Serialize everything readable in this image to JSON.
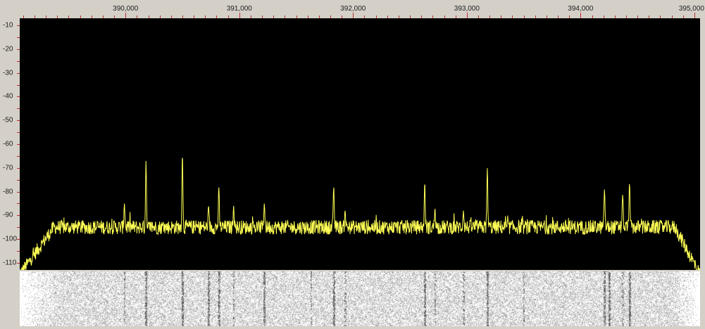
{
  "frequency_axis": {
    "labels": [
      "390,000",
      "391,000",
      "392,000",
      "393,000",
      "394,000",
      "395,000"
    ],
    "values": [
      390,
      391,
      392,
      393,
      394,
      395
    ],
    "range": [
      389.07,
      395.05
    ]
  },
  "level_axis": {
    "labels": [
      "-10",
      "-20",
      "-30",
      "-40",
      "-50",
      "-60",
      "-70",
      "-80",
      "-90",
      "-100",
      "-110"
    ],
    "values": [
      -10,
      -20,
      -30,
      -40,
      -50,
      -60,
      -70,
      -80,
      -90,
      -100,
      -110
    ],
    "range": [
      -7,
      -113
    ]
  },
  "spectrum": {
    "trace_color": "#ffff55",
    "background_color": "#000000",
    "noise_floor_db": -95,
    "band_edges": [
      389.07,
      395.05
    ],
    "peaks": [
      {
        "freq": 389.99,
        "level": -85
      },
      {
        "freq": 390.18,
        "level": -67
      },
      {
        "freq": 390.5,
        "level": -64
      },
      {
        "freq": 390.73,
        "level": -86
      },
      {
        "freq": 390.82,
        "level": -78
      },
      {
        "freq": 390.95,
        "level": -86
      },
      {
        "freq": 391.22,
        "level": -85
      },
      {
        "freq": 391.83,
        "level": -78
      },
      {
        "freq": 391.93,
        "level": -88
      },
      {
        "freq": 392.63,
        "level": -76
      },
      {
        "freq": 392.72,
        "level": -87
      },
      {
        "freq": 392.97,
        "level": -88
      },
      {
        "freq": 393.18,
        "level": -70
      },
      {
        "freq": 394.21,
        "level": -79
      },
      {
        "freq": 394.37,
        "level": -81
      },
      {
        "freq": 394.43,
        "level": -76
      }
    ]
  },
  "waterfall": {
    "dark_lines": [
      390.18,
      390.5,
      390.73,
      390.82,
      391.22,
      391.83,
      392.63,
      393.18,
      394.21,
      394.25,
      394.43
    ],
    "faint_lines": [
      389.99,
      390.95,
      391.63,
      391.93,
      392.72,
      392.97,
      393.5,
      394.37
    ]
  }
}
